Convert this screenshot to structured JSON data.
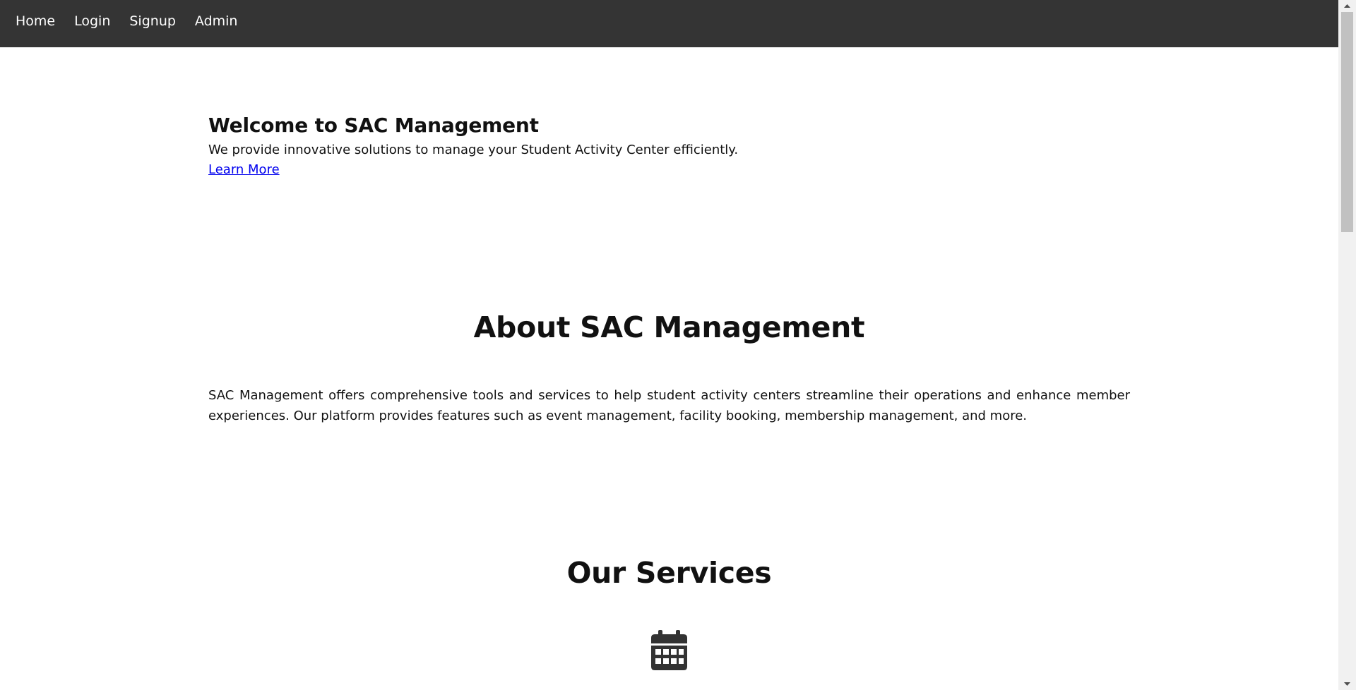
{
  "nav": {
    "items": [
      {
        "label": "Home"
      },
      {
        "label": "Login"
      },
      {
        "label": "Signup"
      },
      {
        "label": "Admin"
      }
    ]
  },
  "hero": {
    "title": "Welcome to SAC Management",
    "text": "We provide innovative solutions to manage your Student Activity Center efficiently.",
    "link_label": "Learn More"
  },
  "about": {
    "title": "About SAC Management",
    "text": "SAC Management offers comprehensive tools and services to help student activity centers streamline their operations and enhance member experiences. Our platform provides features such as event management, facility booking, membership management, and more."
  },
  "services": {
    "title": "Our Services",
    "icon": "calendar-icon"
  },
  "colors": {
    "navbar_bg": "#343434",
    "link": "#0000ee",
    "text": "#111111",
    "icon": "#333333"
  }
}
